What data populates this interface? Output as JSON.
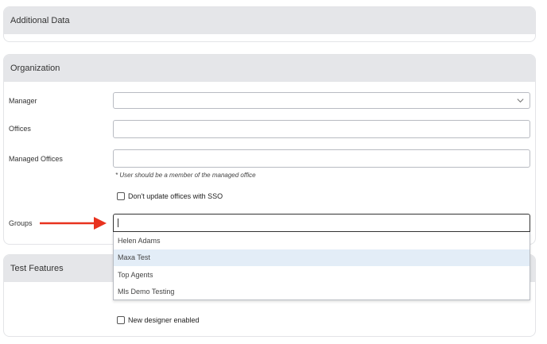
{
  "sections": {
    "additional": {
      "title": "Additional Data"
    },
    "organization": {
      "title": "Organization",
      "manager": {
        "label": "Manager",
        "value": ""
      },
      "offices": {
        "label": "Offices",
        "value": ""
      },
      "managed_offices": {
        "label": "Managed Offices",
        "value": "",
        "hint": "* User should be a member of the managed office"
      },
      "dont_update_sso": {
        "label": "Don't update offices with SSO",
        "checked": false
      },
      "groups": {
        "label": "Groups",
        "value": "",
        "options": [
          "Helen Adams",
          "Maxa Test",
          "Top Agents",
          "Mls Demo Testing"
        ],
        "highlighted_option": "Maxa Test"
      }
    },
    "test_features": {
      "title": "Test Features",
      "new_designer": {
        "label": "New designer enabled",
        "checked": false
      }
    }
  },
  "colors": {
    "header_bg": "#e5e6e9",
    "arrow": "#e8321e",
    "highlight": "#e3edf7"
  },
  "icons": {
    "manager_select": "chevron-down-icon",
    "annotation": "red-arrow-icon"
  }
}
